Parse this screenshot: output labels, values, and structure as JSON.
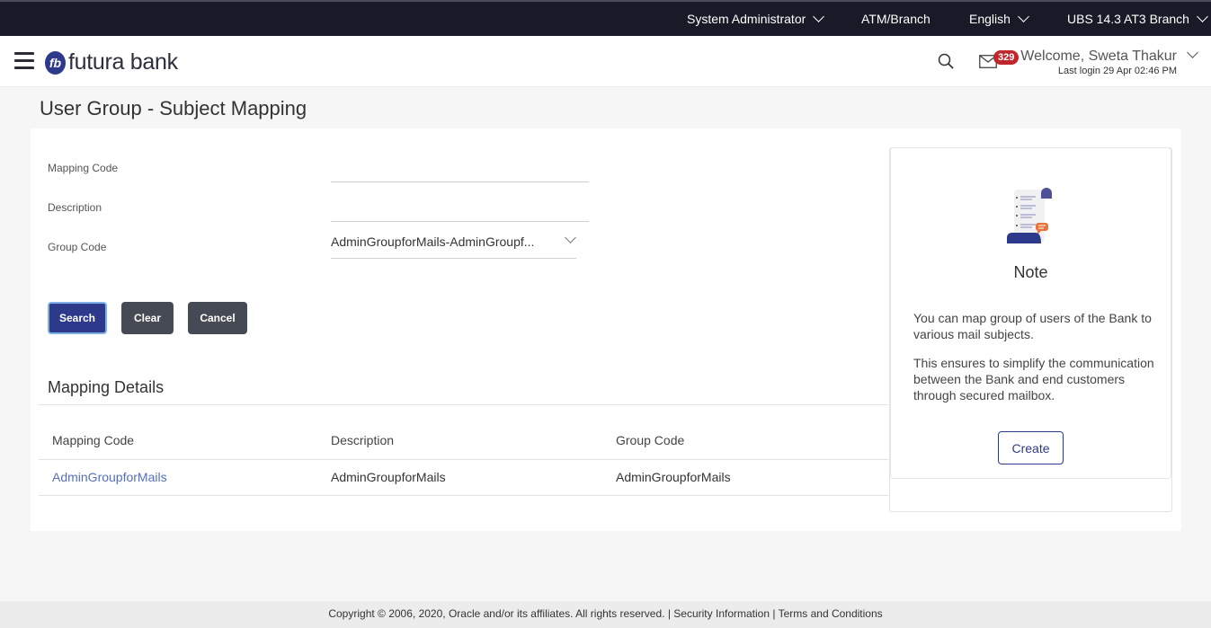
{
  "topbar": {
    "role": "System Administrator",
    "location": "ATM/Branch",
    "language": "English",
    "branch": "UBS 14.3 AT3 Branch"
  },
  "header": {
    "logo_mark": "fb",
    "brand": "futura bank",
    "mail_count": "329",
    "welcome": "Welcome, Sweta Thakur",
    "last_login": "Last login 29 Apr 02:46 PM"
  },
  "page": {
    "title": "User Group - Subject Mapping"
  },
  "form": {
    "mapping_code_label": "Mapping Code",
    "mapping_code_value": "",
    "description_label": "Description",
    "description_value": "",
    "group_code_label": "Group Code",
    "group_code_value": "AdminGroupforMails-AdminGroupf..."
  },
  "buttons": {
    "search": "Search",
    "clear": "Clear",
    "cancel": "Cancel",
    "create": "Create"
  },
  "results": {
    "title": "Mapping Details",
    "columns": [
      "Mapping Code",
      "Description",
      "Group Code"
    ],
    "rows": [
      [
        "AdminGroupforMails",
        "AdminGroupforMails",
        "AdminGroupforMails"
      ]
    ]
  },
  "note": {
    "title": "Note",
    "paragraphs": [
      "You can map group of users of the Bank to various mail subjects.",
      "This ensures to simplify the communication between the Bank and end customers through secured mailbox."
    ]
  },
  "footer": {
    "copyright": "Copyright © 2006, 2020, Oracle and/or its affiliates. All rights reserved.",
    "separator": " | ",
    "security": "Security Information",
    "terms": "Terms and Conditions"
  },
  "colors": {
    "primary": "#2d3a8c",
    "topbar": "#181a27",
    "badge": "#c0272d",
    "link": "#5670b6",
    "secondary_button": "#464a55"
  }
}
